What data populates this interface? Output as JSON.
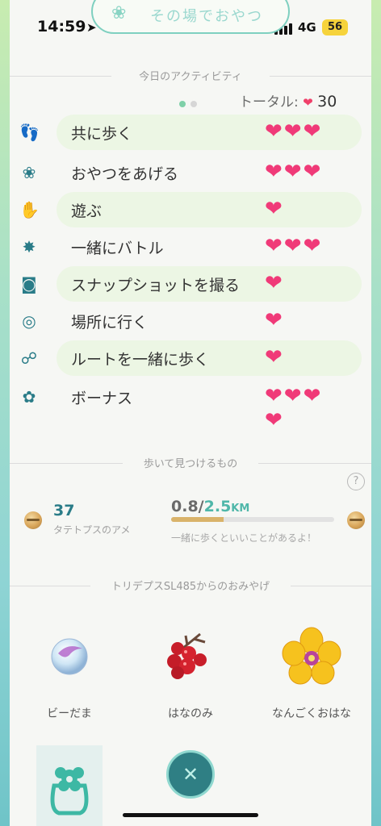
{
  "status": {
    "time": "14:59",
    "network": "4G",
    "battery": "56"
  },
  "header": {
    "title": "その場でおやつ"
  },
  "activities": {
    "section_title": "今日のアクティビティ",
    "total_label": "トータル:",
    "total_value": "30",
    "pager": {
      "count": 2,
      "active": 0
    },
    "items": [
      {
        "label": "共に歩く",
        "icon": "footprints-icon",
        "hearts": 3,
        "highlighted": true
      },
      {
        "label": "おやつをあげる",
        "icon": "berries-icon",
        "hearts": 3,
        "highlighted": false
      },
      {
        "label": "遊ぶ",
        "icon": "wave-hand-icon",
        "hearts": 1,
        "highlighted": true
      },
      {
        "label": "一緒にバトル",
        "icon": "battle-icon",
        "hearts": 3,
        "highlighted": false
      },
      {
        "label": "スナップショットを撮る",
        "icon": "camera-icon",
        "hearts": 1,
        "highlighted": true
      },
      {
        "label": "場所に行く",
        "icon": "pokestop-icon",
        "hearts": 1,
        "highlighted": false
      },
      {
        "label": "ルートを一緒に歩く",
        "icon": "route-icon",
        "hearts": 1,
        "highlighted": true
      },
      {
        "label": "ボーナス",
        "icon": "flower-icon",
        "hearts": 4,
        "highlighted": false
      }
    ]
  },
  "walk": {
    "section_title": "歩いて見つけるもの",
    "candy_count": "37",
    "candy_name": "タテトプスのアメ",
    "distance_current": "0.8",
    "distance_goal": "2.5",
    "distance_unit": "KM",
    "progress": 0.32,
    "hint": "一緒に歩くといいことがあるよ！"
  },
  "souvenirs": {
    "section_title": "トリデプスSL485からのおみやげ",
    "items": [
      {
        "name": "ビーだま",
        "icon": "marble-icon"
      },
      {
        "name": "はなのみ",
        "icon": "berries-icon"
      },
      {
        "name": "なんごくおはな",
        "icon": "tropical-flower-icon"
      }
    ]
  },
  "colors": {
    "accent": "#2a7c88",
    "heart": "#f03a78",
    "highlight": "#ecf6e4"
  }
}
